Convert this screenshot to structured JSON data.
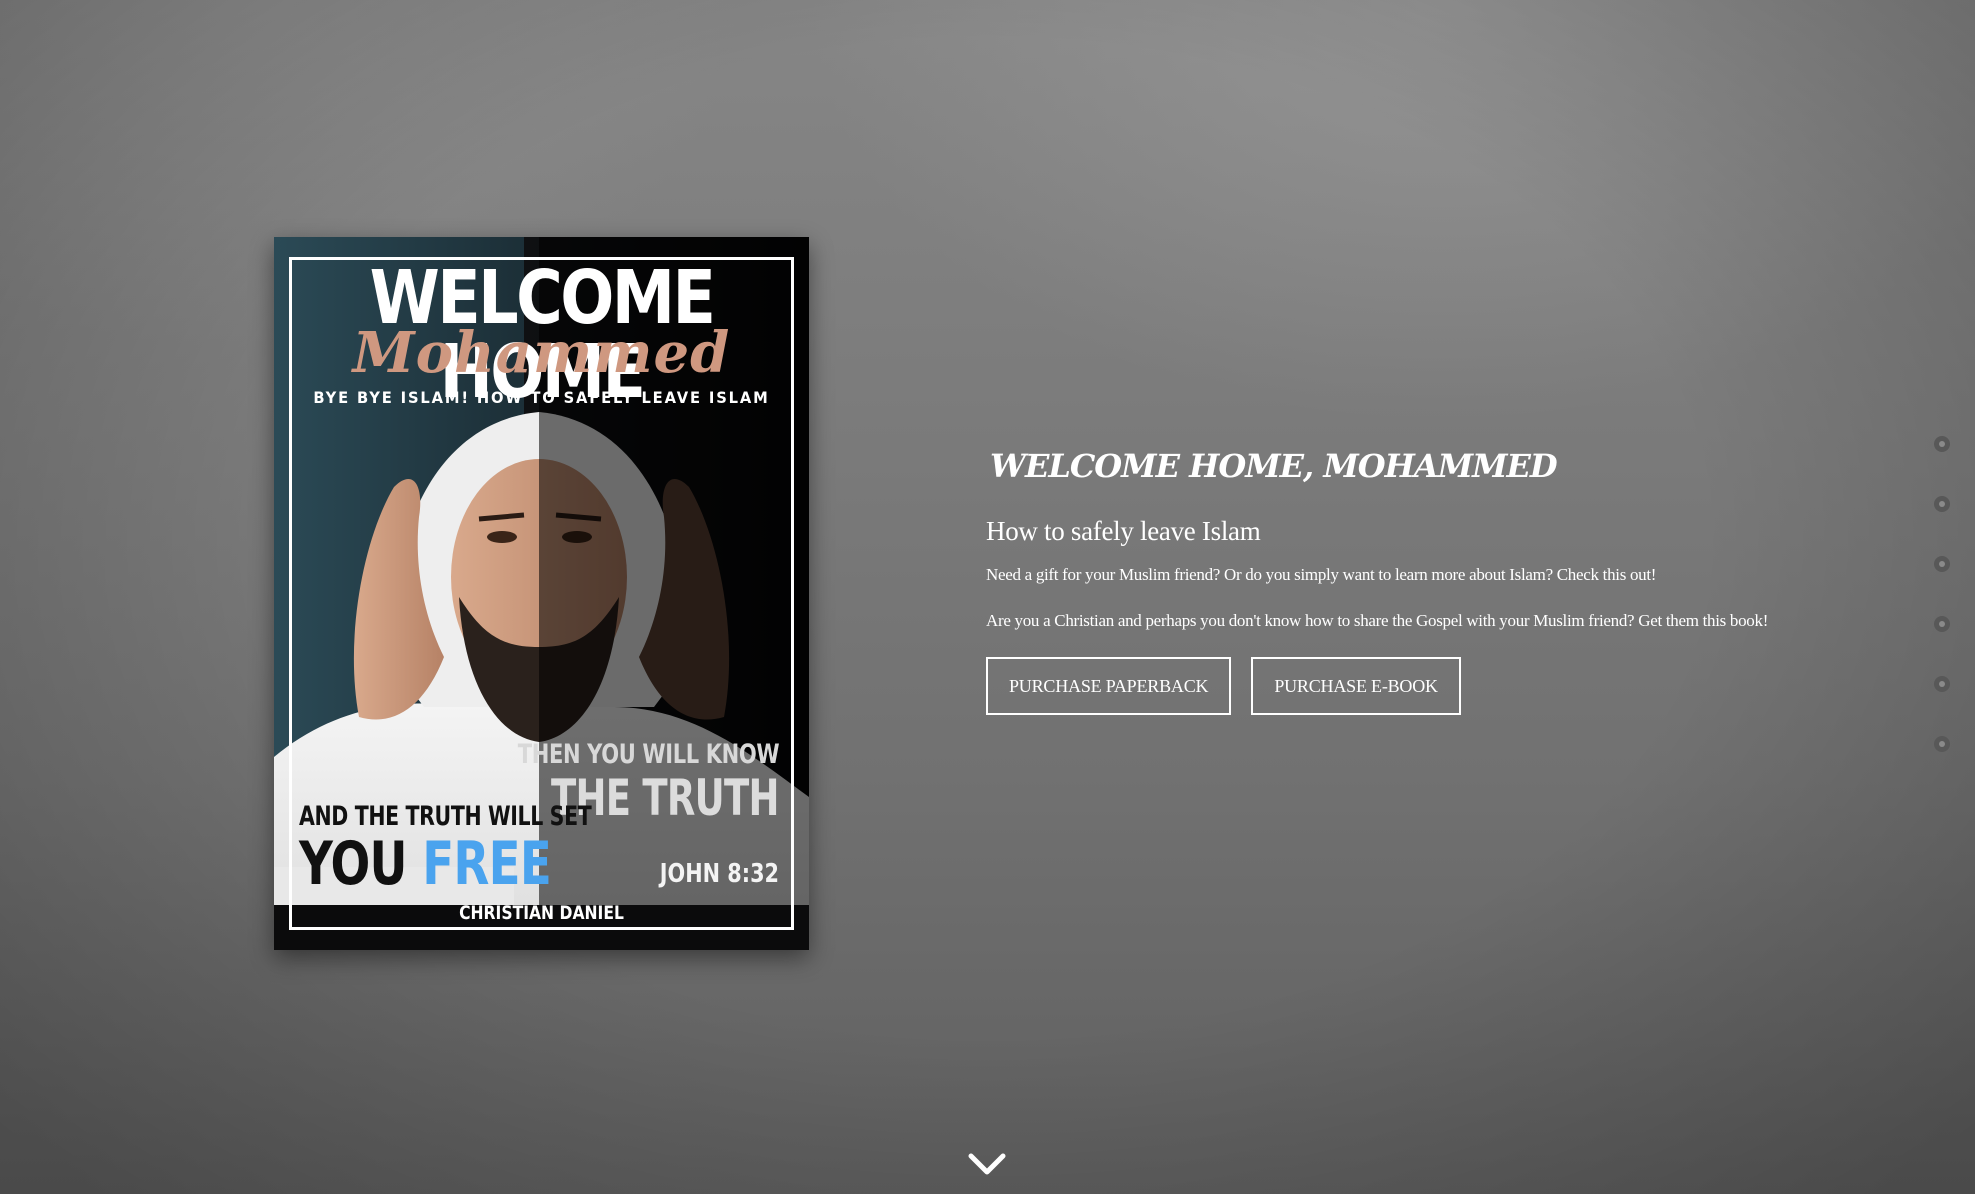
{
  "book": {
    "cover": {
      "title": "WELCOME HOME",
      "script_name": "Mohammed",
      "subtitle": "BYE BYE ISLAM! HOW TO SAFELY LEAVE ISLAM",
      "quote_line1": "THEN YOU WILL KNOW",
      "quote_line2": "THE TRUTH",
      "quote_line3": "AND THE TRUTH WILL SET",
      "quote_line4_a": "YOU",
      "quote_line4_b": "FREE",
      "verse": "JOHN 8:32",
      "author": "CHRISTIAN DANIEL"
    }
  },
  "hero": {
    "title": "WELCOME HOME, MOHAMMED",
    "subtitle": "How to safely leave Islam",
    "paragraph1": "Need a gift for your Muslim friend? Or do you simply want to learn more about Islam? Check this out!",
    "paragraph2": "Are you a Christian and perhaps you don't know how to share the Gospel with your Muslim friend? Get them this book!",
    "buttons": {
      "paperback": "PURCHASE PAPERBACK",
      "ebook": "PURCHASE E-BOOK"
    }
  },
  "nav": {
    "section_dots": 6
  },
  "icons": {
    "scroll": "chevron-down-icon",
    "dots": "section-dot-icon"
  },
  "colors": {
    "accent_blue": "#4aa3ee",
    "script_rose": "#cf9880",
    "text": "#ffffff"
  }
}
